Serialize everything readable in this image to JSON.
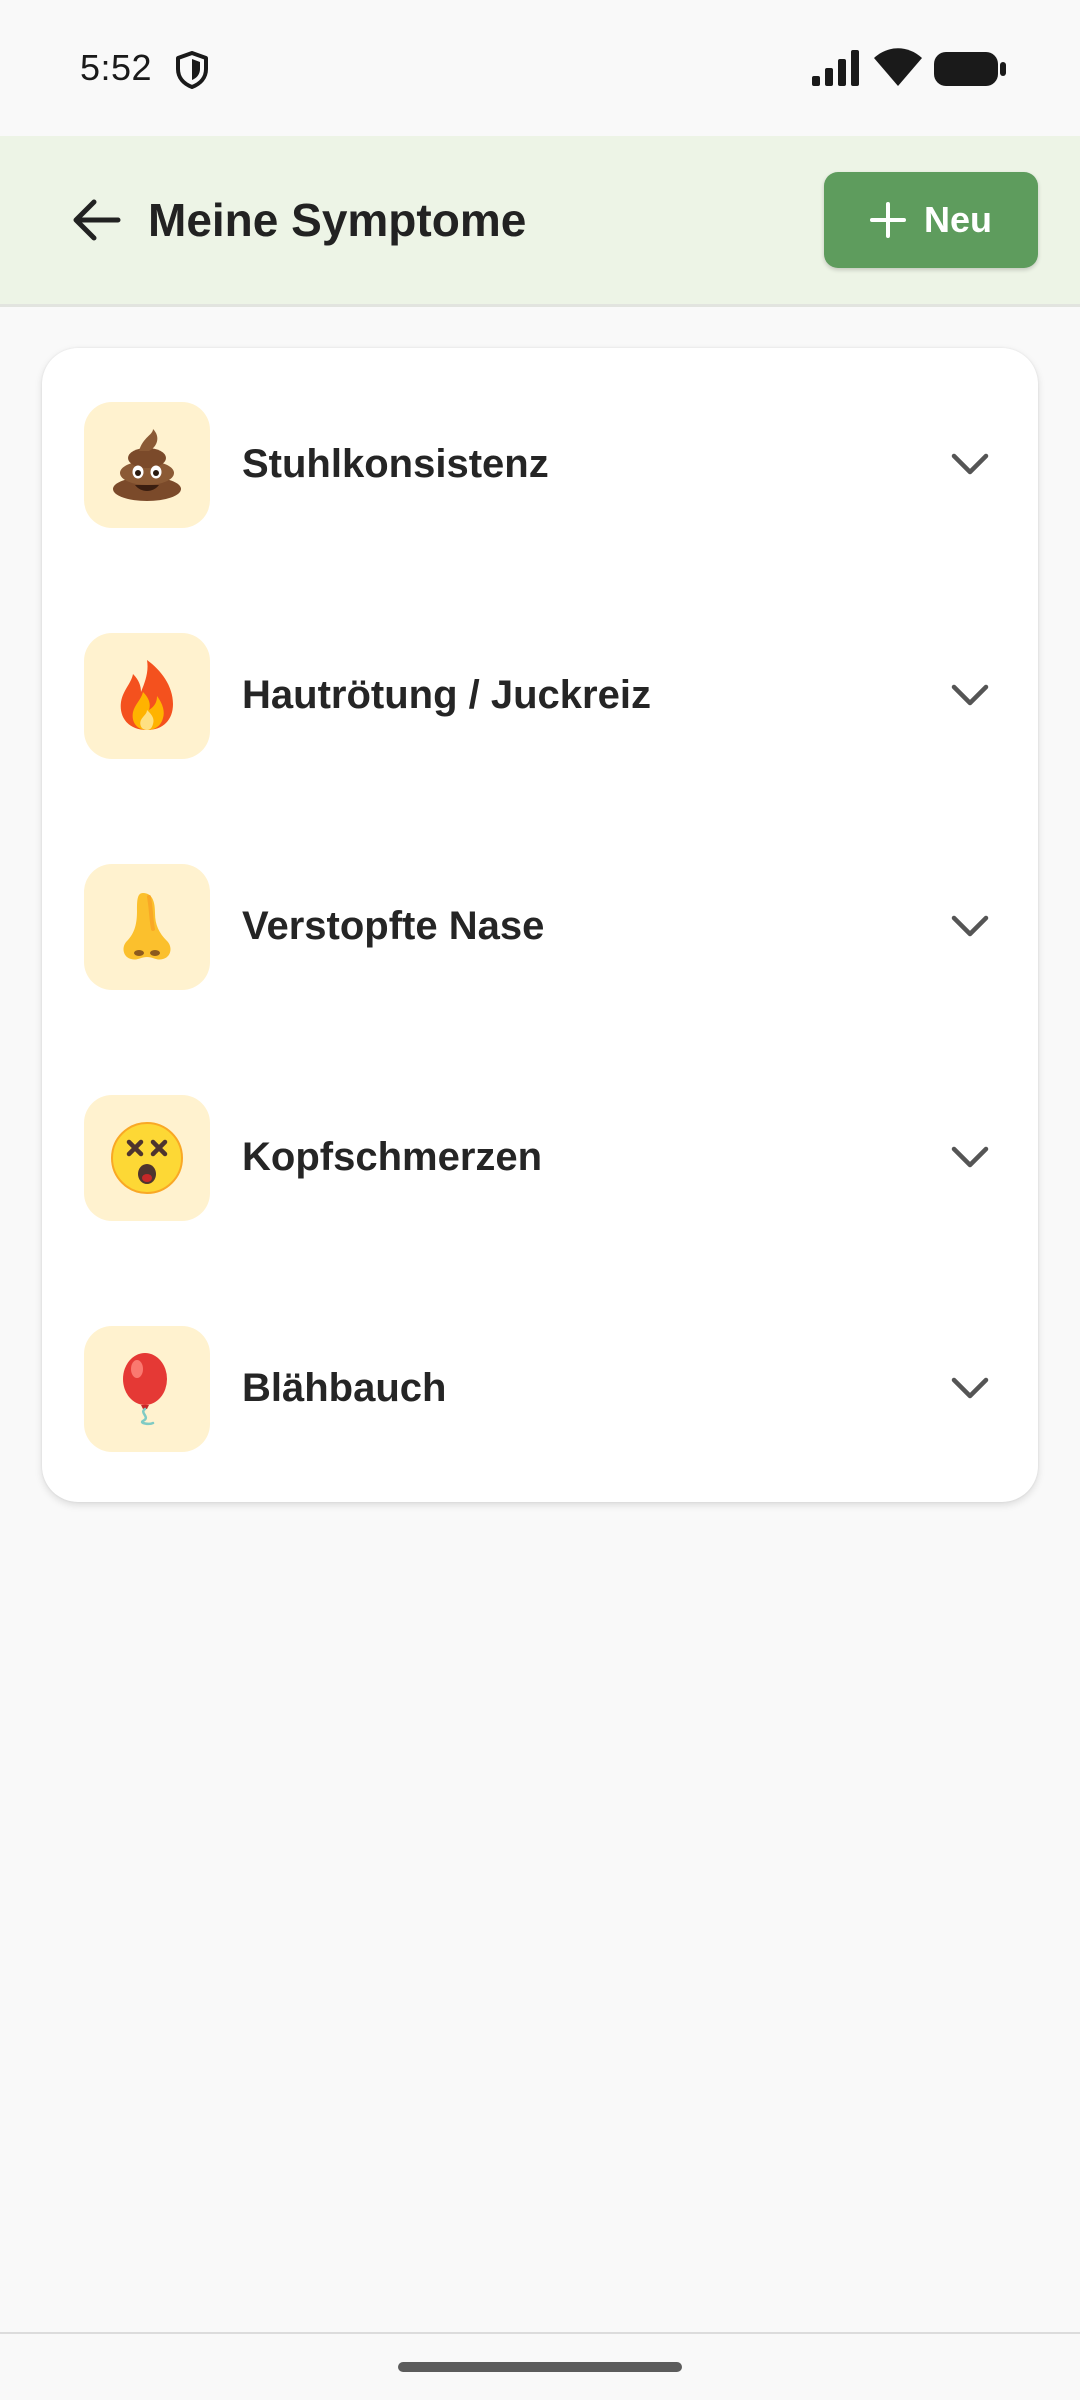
{
  "status_bar": {
    "time": "5:52"
  },
  "app_bar": {
    "title": "Meine Symptome",
    "new_button_label": "Neu"
  },
  "symptoms": [
    {
      "label": "Stuhlkonsistenz",
      "icon": "poop-emoji-icon"
    },
    {
      "label": "Hautrötung / Juckreiz",
      "icon": "fire-emoji-icon"
    },
    {
      "label": "Verstopfte Nase",
      "icon": "nose-emoji-icon"
    },
    {
      "label": "Kopfschmerzen",
      "icon": "dizzy-face-emoji-icon"
    },
    {
      "label": "Blähbauch",
      "icon": "balloon-emoji-icon"
    }
  ],
  "colors": {
    "app_bar_background": "#edf4e6",
    "accent_green": "#5e9c5d",
    "icon_tile_background": "#fff2cf",
    "page_background": "#f9f9f9"
  }
}
